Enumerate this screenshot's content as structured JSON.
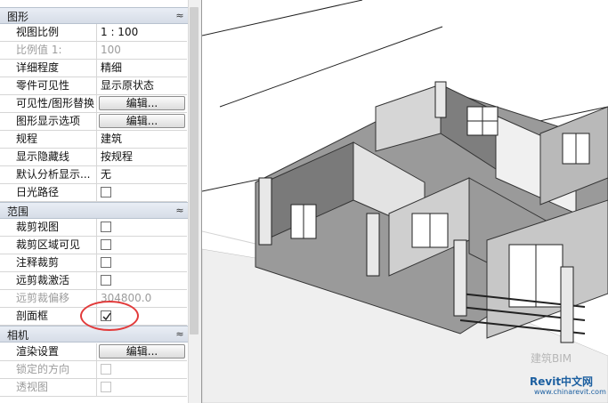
{
  "properties": {
    "graphics": {
      "title": "图形",
      "toggle": "≈",
      "rows": [
        {
          "label": "视图比例",
          "value": "1 : 100"
        },
        {
          "label": "比例值 1:",
          "value": "100"
        },
        {
          "label": "详细程度",
          "value": "精细"
        },
        {
          "label": "零件可见性",
          "value": "显示原状态"
        },
        {
          "label": "可见性/图形替换",
          "button": "编辑..."
        },
        {
          "label": "图形显示选项",
          "button": "编辑..."
        },
        {
          "label": "规程",
          "value": "建筑"
        },
        {
          "label": "显示隐藏线",
          "value": "按规程"
        },
        {
          "label": "默认分析显示...",
          "value": "无"
        },
        {
          "label": "日光路径"
        }
      ]
    },
    "extents": {
      "title": "范围",
      "toggle": "≈",
      "rows": [
        {
          "label": "裁剪视图"
        },
        {
          "label": "裁剪区域可见"
        },
        {
          "label": "注释裁剪"
        },
        {
          "label": "远剪裁激活"
        },
        {
          "label": "远剪裁偏移",
          "value": "304800.0"
        },
        {
          "label": "剖面框",
          "checked": true
        }
      ]
    },
    "camera": {
      "title": "相机",
      "toggle": "≈",
      "rows": [
        {
          "label": "渲染设置",
          "button": "编辑..."
        },
        {
          "label": "锁定的方向"
        },
        {
          "label": "透视图"
        }
      ]
    }
  },
  "annotation": {
    "color": "#e23b3b",
    "target": "剖面框"
  },
  "watermark": {
    "text1": "Revit中文网",
    "text2": "www.chinarevit.com",
    "text3": "建筑BIM"
  }
}
